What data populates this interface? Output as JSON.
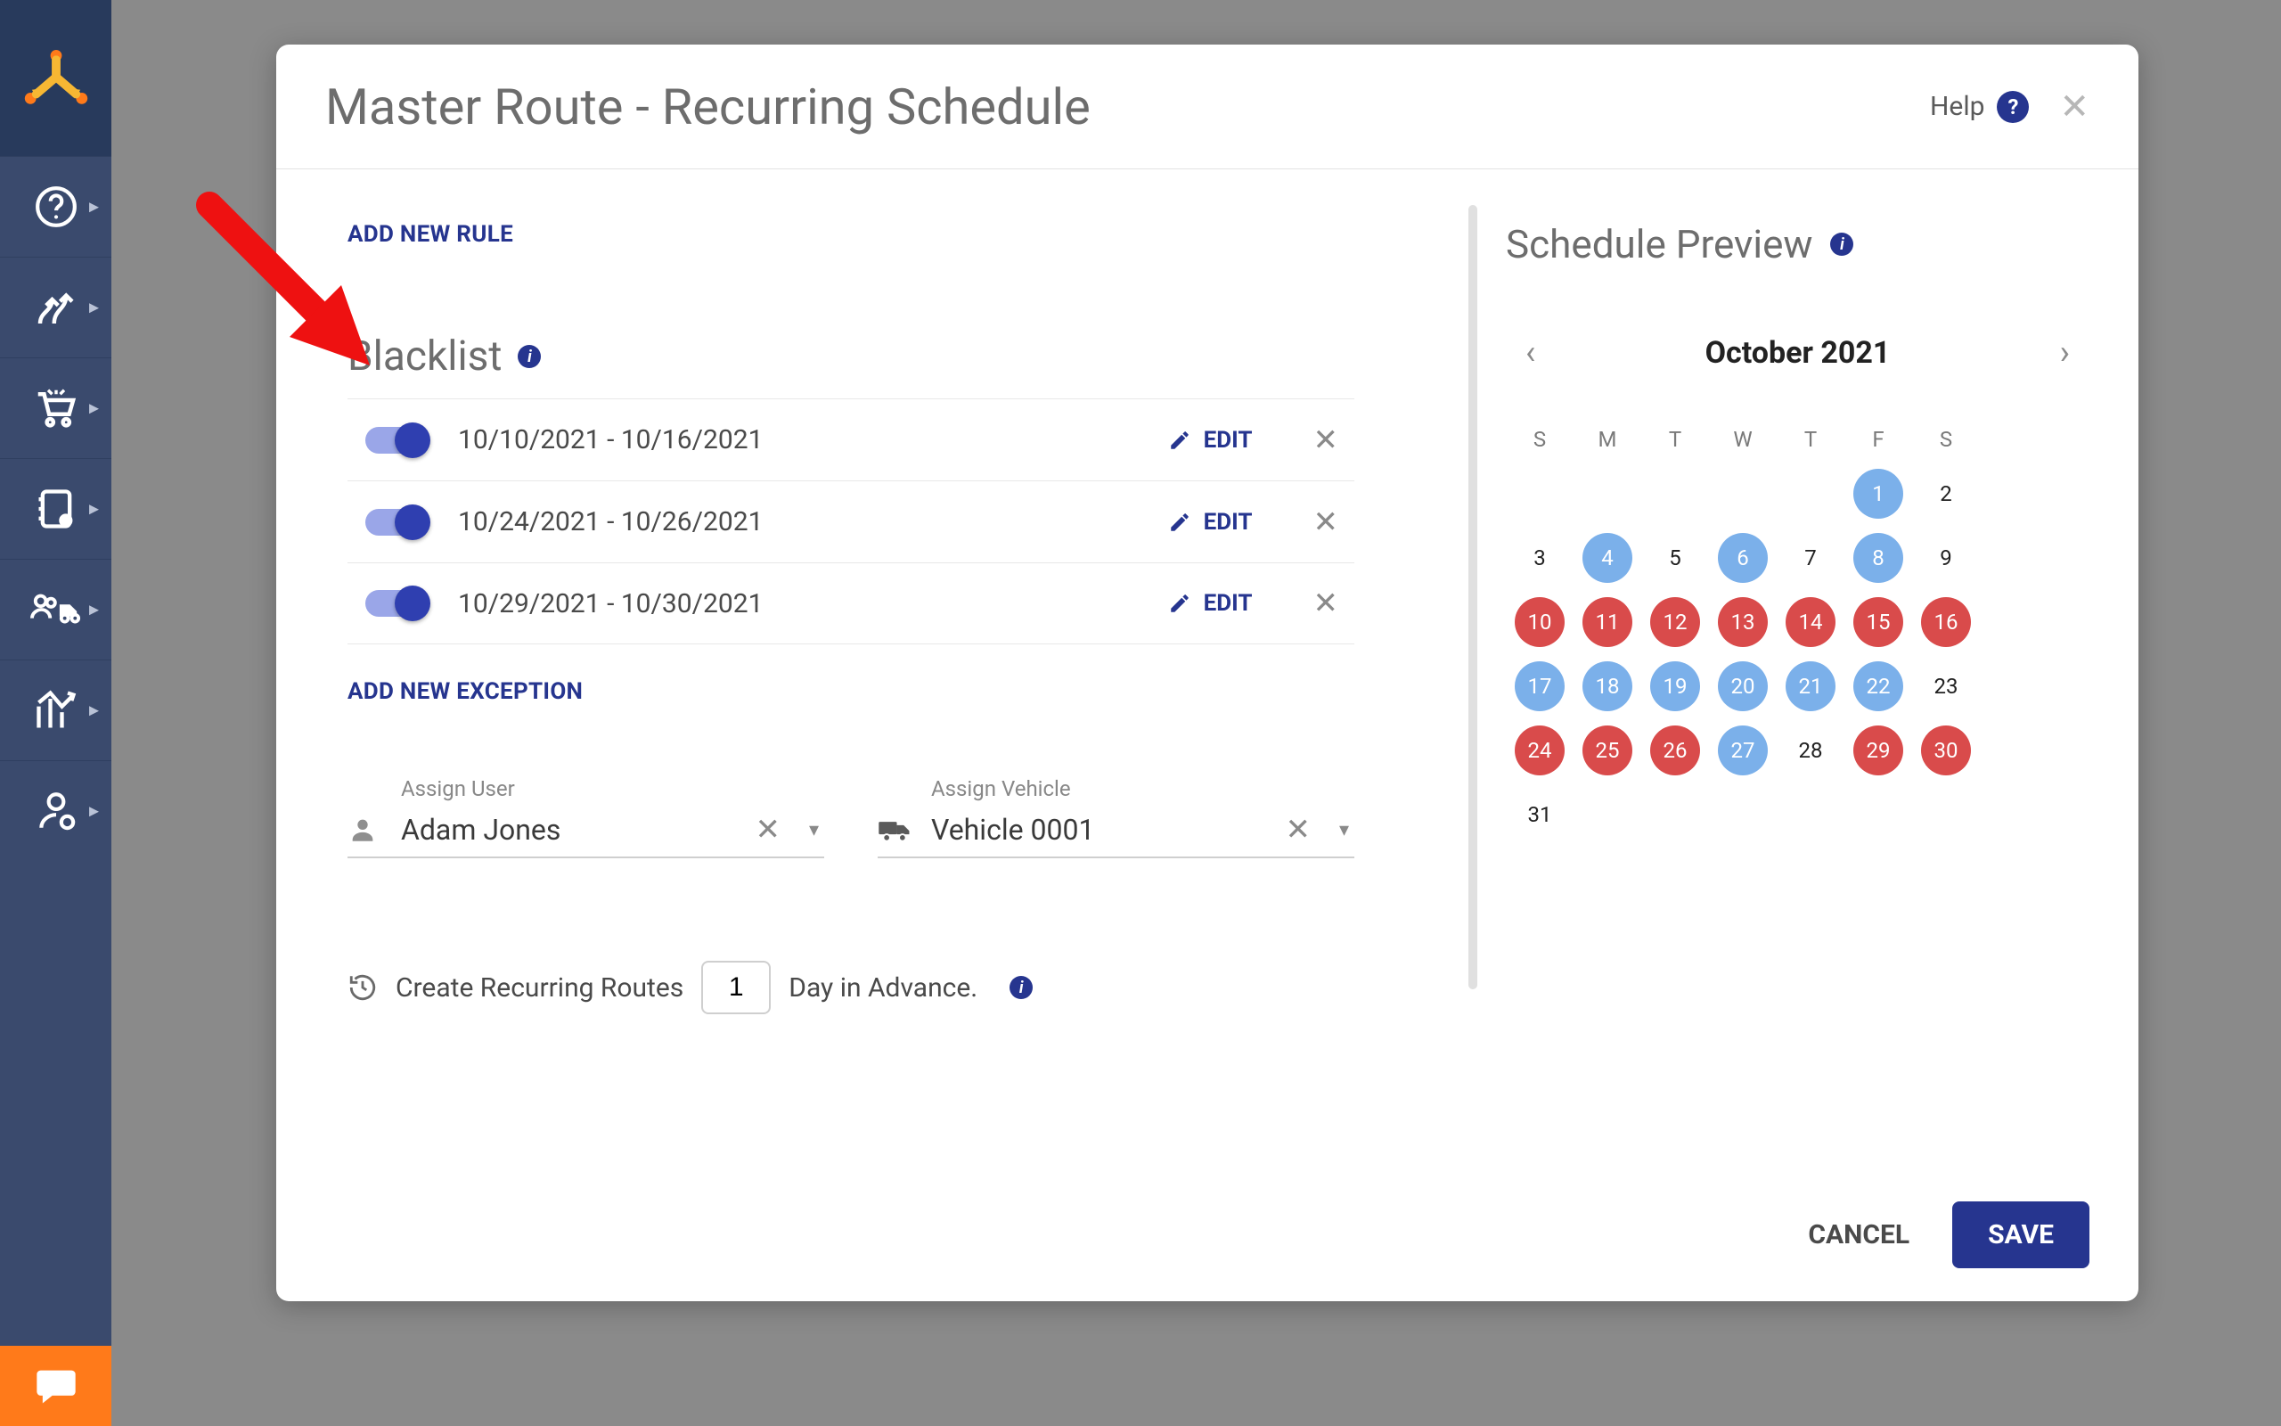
{
  "modal": {
    "title": "Master Route - Recurring Schedule",
    "help_label": "Help",
    "sections": {
      "add_rule_label": "ADD NEW RULE",
      "blacklist_title": "Blacklist",
      "add_exception_label": "ADD NEW EXCEPTION"
    },
    "blacklist": [
      {
        "range": "10/10/2021 - 10/16/2021",
        "edit": "EDIT"
      },
      {
        "range": "10/24/2021 - 10/26/2021",
        "edit": "EDIT"
      },
      {
        "range": "10/29/2021 - 10/30/2021",
        "edit": "EDIT"
      }
    ],
    "assign_user_label": "Assign User",
    "assign_user_value": "Adam Jones",
    "assign_vehicle_label": "Assign Vehicle",
    "assign_vehicle_value": "Vehicle 0001",
    "advance": {
      "prefix": "Create Recurring Routes",
      "value": "1",
      "suffix": "Day in Advance."
    },
    "footer": {
      "cancel": "CANCEL",
      "save": "SAVE"
    }
  },
  "preview": {
    "title": "Schedule Preview",
    "month": "October 2021",
    "dow": [
      "S",
      "M",
      "T",
      "W",
      "T",
      "F",
      "S"
    ],
    "cells": [
      {
        "d": "",
        "s": "empty"
      },
      {
        "d": "",
        "s": "empty"
      },
      {
        "d": "",
        "s": "empty"
      },
      {
        "d": "",
        "s": "empty"
      },
      {
        "d": "",
        "s": "empty"
      },
      {
        "d": "1",
        "s": "blue"
      },
      {
        "d": "2",
        "s": "plain"
      },
      {
        "d": "3",
        "s": "plain"
      },
      {
        "d": "4",
        "s": "blue"
      },
      {
        "d": "5",
        "s": "plain"
      },
      {
        "d": "6",
        "s": "blue"
      },
      {
        "d": "7",
        "s": "plain"
      },
      {
        "d": "8",
        "s": "blue"
      },
      {
        "d": "9",
        "s": "plain"
      },
      {
        "d": "10",
        "s": "red"
      },
      {
        "d": "11",
        "s": "red"
      },
      {
        "d": "12",
        "s": "red"
      },
      {
        "d": "13",
        "s": "red"
      },
      {
        "d": "14",
        "s": "red"
      },
      {
        "d": "15",
        "s": "red"
      },
      {
        "d": "16",
        "s": "red"
      },
      {
        "d": "17",
        "s": "blue"
      },
      {
        "d": "18",
        "s": "blue"
      },
      {
        "d": "19",
        "s": "blue"
      },
      {
        "d": "20",
        "s": "blue"
      },
      {
        "d": "21",
        "s": "blue"
      },
      {
        "d": "22",
        "s": "blue"
      },
      {
        "d": "23",
        "s": "plain"
      },
      {
        "d": "24",
        "s": "red"
      },
      {
        "d": "25",
        "s": "red"
      },
      {
        "d": "26",
        "s": "red"
      },
      {
        "d": "27",
        "s": "blue"
      },
      {
        "d": "28",
        "s": "plain"
      },
      {
        "d": "29",
        "s": "red"
      },
      {
        "d": "30",
        "s": "red"
      },
      {
        "d": "31",
        "s": "plain"
      }
    ]
  }
}
